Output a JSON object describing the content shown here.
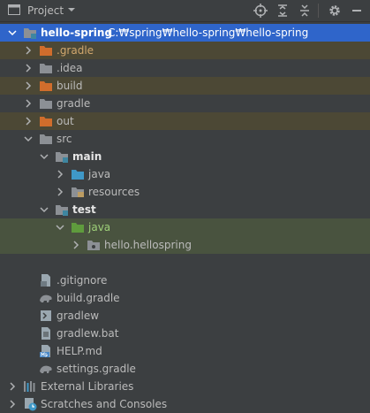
{
  "header": {
    "title": "Project",
    "tools": [
      "locate-icon",
      "expand-all-icon",
      "collapse-all-icon",
      "settings-icon",
      "hide-icon"
    ]
  },
  "tree": {
    "root": {
      "label": "hello-spring",
      "path": "C:₩spring₩hello-spring₩hello-spring"
    },
    "gradle_dot": ".gradle",
    "idea": ".idea",
    "build": "build",
    "gradle": "gradle",
    "out": "out",
    "src": "src",
    "main": "main",
    "java_main": "java",
    "resources": "resources",
    "test": "test",
    "java_test": "java",
    "pkg": "hello.hellospring",
    "gitignore": ".gitignore",
    "build_gradle": "build.gradle",
    "gradlew": "gradlew",
    "gradlew_bat": "gradlew.bat",
    "help_md": "HELP.md",
    "settings_gradle": "settings.gradle",
    "external": "External Libraries",
    "scratches": "Scratches and Consoles"
  },
  "colors": {
    "background": "#3c3f41",
    "selection": "#2f65ca",
    "excluded": "#4c4835",
    "test_row": "#49533f",
    "folder_gray": "#8c9095",
    "folder_orange": "#d06d2c",
    "folder_blue": "#3f98c8",
    "folder_green": "#5f9b3d"
  }
}
